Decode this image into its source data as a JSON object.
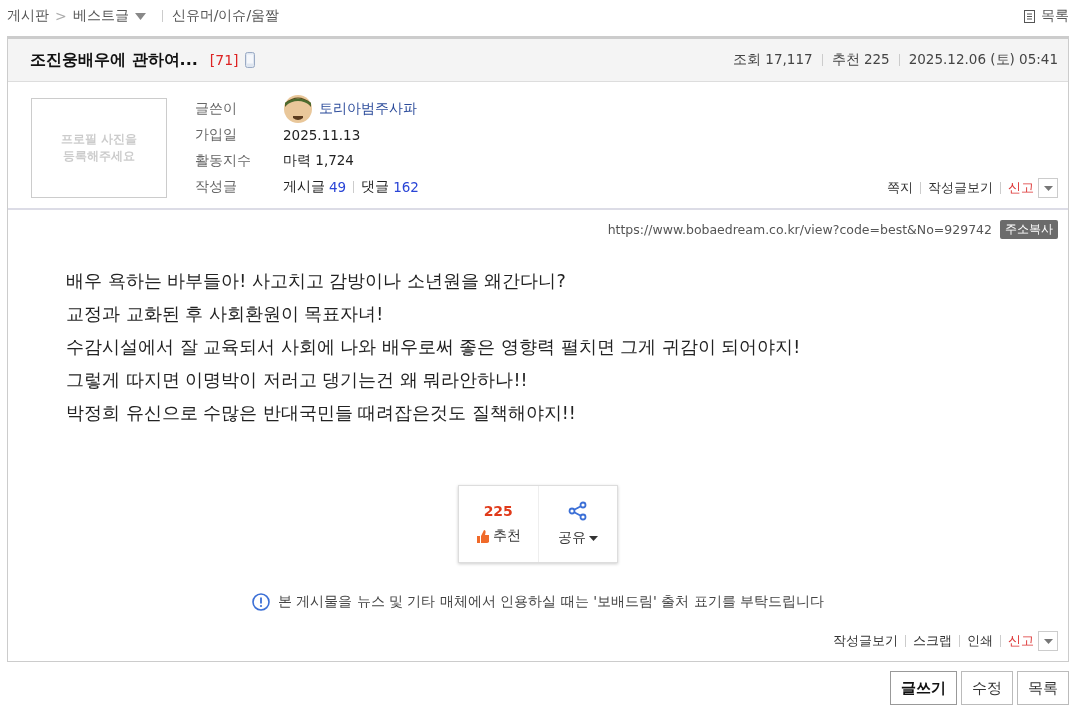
{
  "breadcrumb": {
    "root": "게시판",
    "separator": ">",
    "board": "베스트글",
    "category": "신유머/이슈/움짤"
  },
  "list_link": "목록",
  "post": {
    "title": "조진웅배우에 관하여...",
    "comment_count": "[71]",
    "mobile": true,
    "stats": [
      {
        "kind": "count",
        "label": "조회",
        "value": "17,117"
      },
      {
        "kind": "count",
        "label": "추천",
        "value": "225"
      },
      {
        "kind": "date",
        "value": "2025.12.06 (토) 05:41"
      }
    ]
  },
  "profile": {
    "photo_placeholder": "프로필 사진을 등록해주세요",
    "fields": [
      {
        "kind": "author",
        "label": "글쓴이",
        "value": "토리아범주사파"
      },
      {
        "kind": "plain",
        "label": "가입일",
        "value": "2025.11.13"
      },
      {
        "kind": "plain",
        "label": "활동지수",
        "value": "마력 1,724"
      },
      {
        "kind": "posts",
        "label": "작성글",
        "posts_label": "게시글",
        "posts": "49",
        "comments_label": "댓글",
        "comments": "162"
      }
    ],
    "actions": [
      {
        "label": "쪽지",
        "kind": "normal"
      },
      {
        "label": "작성글보기",
        "kind": "normal"
      },
      {
        "label": "신고",
        "kind": "report"
      }
    ]
  },
  "url": "https://www.bobaedream.co.kr/view?code=best&No=929742",
  "copy_button": "주소복사",
  "body": [
    "배우 욕하는 바부들아! 사고치고 감방이나 소년원을 왜간다니?",
    "교정과 교화된 후 사회환원이 목표자녀!",
    "수감시설에서 잘 교육되서 사회에 나와 배우로써 좋은 영향력 펼치면 그게 귀감이 되어야지!",
    "그렇게 따지면 이명박이 저러고 댕기는건 왜 뭐라안하나!!",
    "박정희 유신으로 수많은 반대국민들 때려잡은것도 질책해야지!!"
  ],
  "recommend": {
    "count": "225",
    "label": "추천"
  },
  "share": {
    "label": "공유"
  },
  "notice": "본 게시물을 뉴스 및 기타 매체에서 인용하실 때는 '보배드림' 출처 표기를 부탁드립니다",
  "bottom_actions": [
    {
      "label": "작성글보기",
      "kind": "normal"
    },
    {
      "label": "스크랩",
      "kind": "normal"
    },
    {
      "label": "인쇄",
      "kind": "normal"
    },
    {
      "label": "신고",
      "kind": "report"
    }
  ],
  "buttons": [
    {
      "label": "글쓰기",
      "kind": "primary"
    },
    {
      "label": "수정",
      "kind": "normal"
    },
    {
      "label": "목록",
      "kind": "normal"
    }
  ]
}
